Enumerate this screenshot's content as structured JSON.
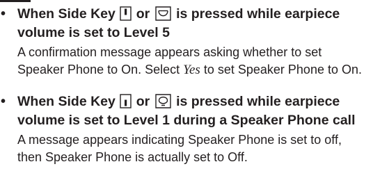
{
  "items": [
    {
      "heading_line1_a": "When Side Key",
      "heading_or": "or",
      "heading_line1_b": "is pressed while earpiece",
      "heading_line2": "volume is set to Level 5",
      "body_line1": "A confirmation message appears asking whether to set",
      "body_line2_a": "Speaker Phone to On. Select",
      "body_line2_em": "Yes",
      "body_line2_b": "to set Speaker Phone to On.",
      "icons": [
        "side-key-up-icon",
        "earpiece-key-icon"
      ]
    },
    {
      "heading_line1_a": "When Side Key",
      "heading_or": "or",
      "heading_line1_b": "is pressed while earpiece",
      "heading_line2": "volume is set to Level 1 during a Speaker Phone call",
      "body_line1": "A message appears indicating Speaker Phone is set to off,",
      "body_line2": "then Speaker Phone is actually set to Off.",
      "icons": [
        "side-key-down-icon",
        "speaker-key-icon"
      ]
    }
  ],
  "bullet": "•",
  "colors": {
    "text": "#231f20",
    "background": "#ffffff"
  }
}
